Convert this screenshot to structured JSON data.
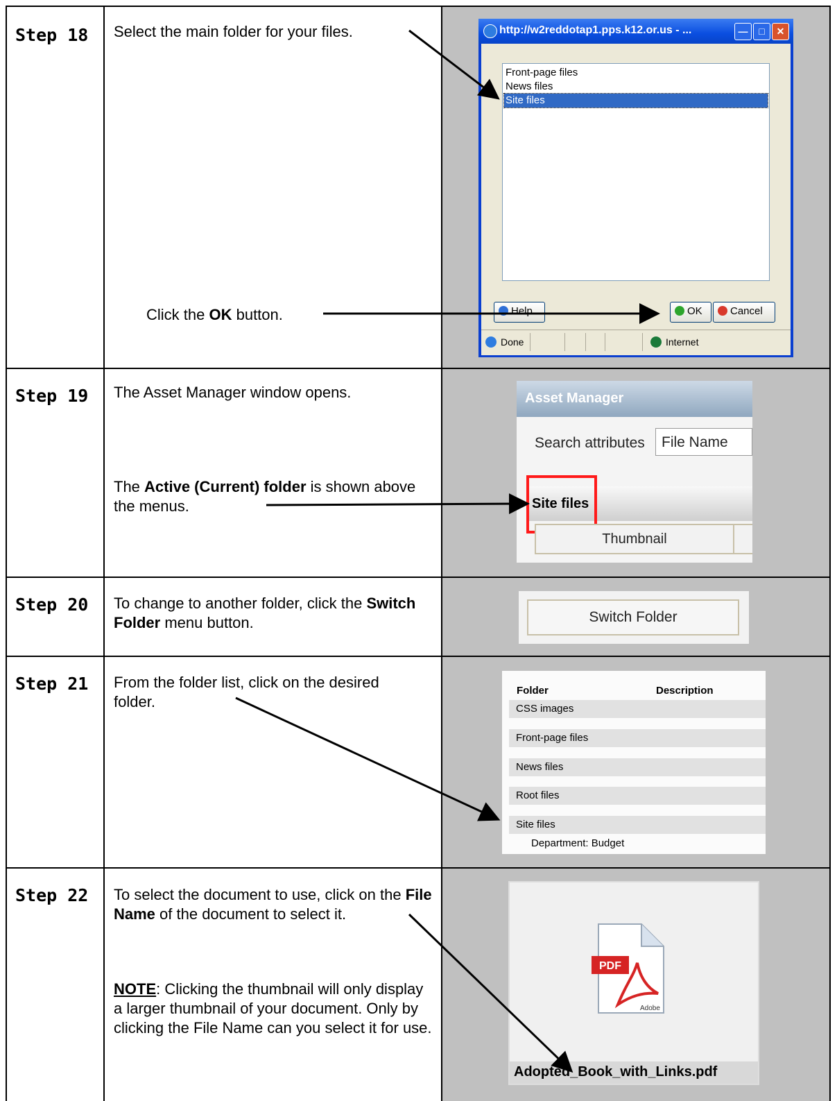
{
  "steps": [
    {
      "label": "Step 18",
      "main_text": "Select the main folder for your files.",
      "ok_pre": "Click the ",
      "ok_bold": "OK",
      "ok_post": " button."
    },
    {
      "label": "Step 19",
      "main_text": "The Asset Manager window opens.",
      "pre": "The ",
      "bold": "Active (Current) folder",
      "post": " is shown above the menus."
    },
    {
      "label": "Step 20",
      "pre": "To change to another folder, click the ",
      "bold": "Switch Folder",
      "post": " menu button."
    },
    {
      "label": "Step 21",
      "main_text": "From the folder list, click on the desired folder."
    },
    {
      "label": "Step 22",
      "pre": "To select the document to use, click on the ",
      "bold": "File Name",
      "post": " of the document to select it.",
      "note_label": "NOTE",
      "note_text": ":  Clicking the thumbnail will only display a larger thumbnail of your document.  Only by clicking the File Name can you select it for use."
    }
  ],
  "dialog": {
    "title": "http://w2reddotap1.pps.k12.or.us - ...",
    "items": [
      "Front-page files",
      "News files",
      "Site files"
    ],
    "selected": "Site files",
    "help_label": "Help",
    "ok_label": "OK",
    "cancel_label": "Cancel",
    "status_left": "Done",
    "status_zone": "Internet"
  },
  "asset_manager": {
    "title": "Asset Manager",
    "search_label": "Search attributes",
    "search_value": "File Name",
    "active_folder": "Site files",
    "tab_label": "Thumbnail"
  },
  "switch_folder": {
    "label": "Switch Folder"
  },
  "folder_list": {
    "col_folder": "Folder",
    "col_description": "Description",
    "rows": [
      "CSS images",
      "Front-page files",
      "News files",
      "Root files",
      "Site files"
    ],
    "sub_text": "Department: Budget"
  },
  "thumbnail": {
    "file_name": "Adopted_Book_with_Links.pdf",
    "pdf_label": "PDF",
    "adobe_label": "Adobe"
  },
  "colors": {
    "highlight": "#316ac5",
    "red_box": "#ff1a1a",
    "xp_blue": "#0a3fd0"
  }
}
